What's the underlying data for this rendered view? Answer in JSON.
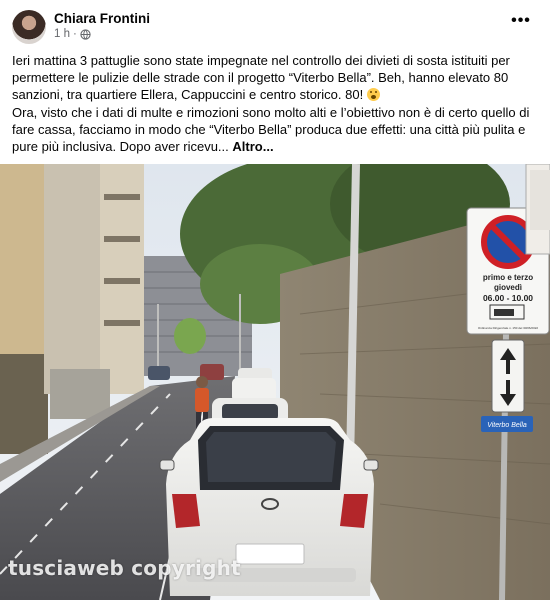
{
  "post": {
    "author": "Chiara Frontini",
    "time": "1 h",
    "separator": "·",
    "more_options_label": "•••",
    "paragraph1": "Ieri mattina 3 pattuglie sono state impegnate nel controllo dei divieti di sosta istituiti per permettere le pulizie delle strade con il progetto “Viterbo Bella”. Beh, hanno elevato 80 sanzioni, tra quartiere Ellera, Cappuccini e centro storico. 80!",
    "emoji": "scream-face-emoji",
    "paragraph2": "Ora, visto che i dati di multe e rimozioni sono molto alti e l’obiettivo non è di certo quello di fare cassa, facciamo in modo che “Viterbo Bella” produca due effetti: una città più pulita e pure più inclusiva. Dopo aver ricevu...",
    "see_more": "Altro..."
  },
  "photo": {
    "sign_line1": "primo e terzo",
    "sign_line2": "giovedì",
    "sign_hours": "06.00 - 10.00",
    "sign_small": "Ordinanza Dirigenziale n. 150 del 30/06/2022",
    "brand_plate": "Viterbo Bella",
    "watermark": "tusciaweb copyright"
  }
}
